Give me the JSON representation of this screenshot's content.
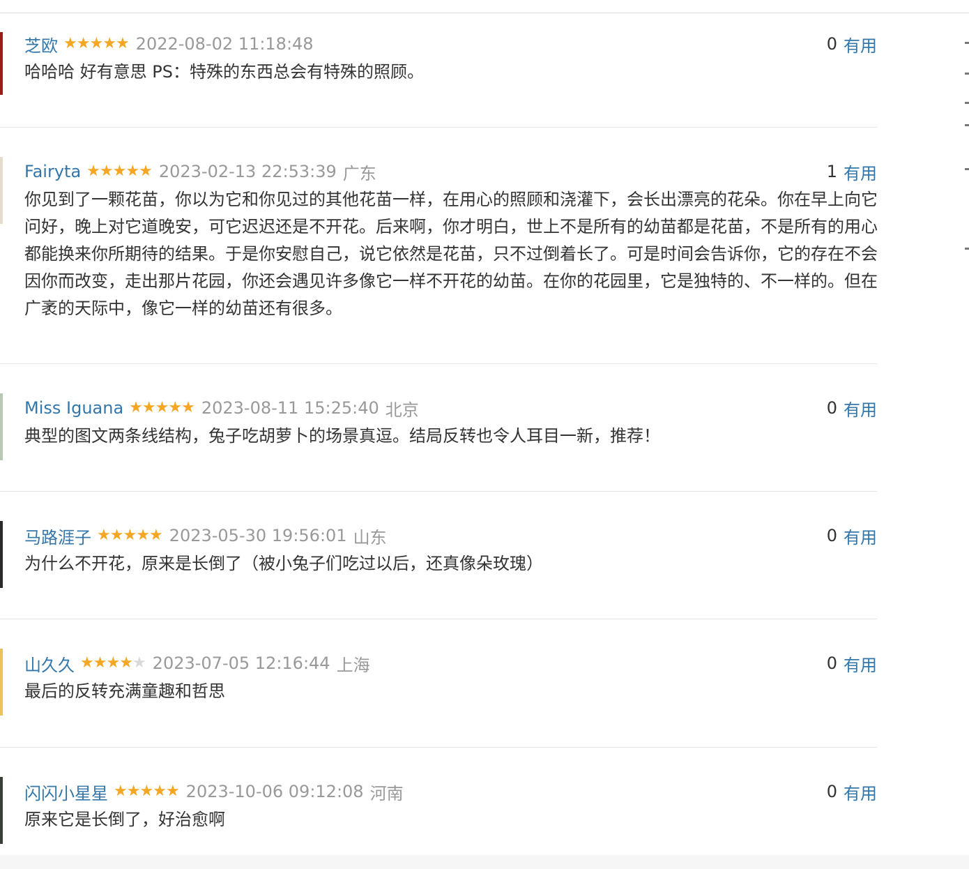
{
  "comments": [
    {
      "user": "芝欧",
      "rating": 5,
      "time": "2022-08-02 11:18:48",
      "location": "",
      "votes": "0",
      "vote_label": "有用",
      "text": "哈哈哈 好有意思 PS：特殊的东西总会有特殊的照顾。",
      "avatar_color": "#9b1b1b"
    },
    {
      "user": "Fairyta",
      "rating": 5,
      "time": "2023-02-13 22:53:39",
      "location": "广东",
      "votes": "1",
      "vote_label": "有用",
      "text": "你见到了一颗花苗，你以为它和你见过的其他花苗一样，在用心的照顾和浇灌下，会长出漂亮的花朵。你在早上向它问好，晚上对它道晚安，可它迟迟还是不开花。后来啊，你才明白，世上不是所有的幼苗都是花苗，不是所有的用心都能换来你所期待的结果。于是你安慰自己，说它依然是花苗，只不过倒着长了。可是时间会告诉你，它的存在不会因你而改变，走出那片花园，你还会遇见许多像它一样不开花的幼苗。在你的花园里，它是独特的、不一样的。但在广袤的天际中，像它一样的幼苗还有很多。",
      "avatar_color": "#e6dccd"
    },
    {
      "user": "Miss Iguana",
      "rating": 5,
      "time": "2023-08-11 15:25:40",
      "location": "北京",
      "votes": "0",
      "vote_label": "有用",
      "text": "典型的图文两条线结构，兔子吃胡萝卜的场景真逗。结局反转也令人耳目一新，推荐！",
      "avatar_color": "#b9c7b4"
    },
    {
      "user": "马路涯子",
      "rating": 5,
      "time": "2023-05-30 19:56:01",
      "location": "山东",
      "votes": "0",
      "vote_label": "有用",
      "text": "为什么不开花，原来是长倒了（被小兔子们吃过以后，还真像朵玫瑰）",
      "avatar_color": "#2a2a2a"
    },
    {
      "user": "山久久",
      "rating": 4,
      "time": "2023-07-05 12:16:44",
      "location": "上海",
      "votes": "0",
      "vote_label": "有用",
      "text": "最后的反转充满童趣和哲思",
      "avatar_color": "#e8c45a"
    },
    {
      "user": "闪闪小星星",
      "rating": 5,
      "time": "2023-10-06 09:12:08",
      "location": "河南",
      "votes": "0",
      "vote_label": "有用",
      "text": "原来它是长倒了，好治愈啊",
      "avatar_color": "#3a3f3a"
    }
  ]
}
